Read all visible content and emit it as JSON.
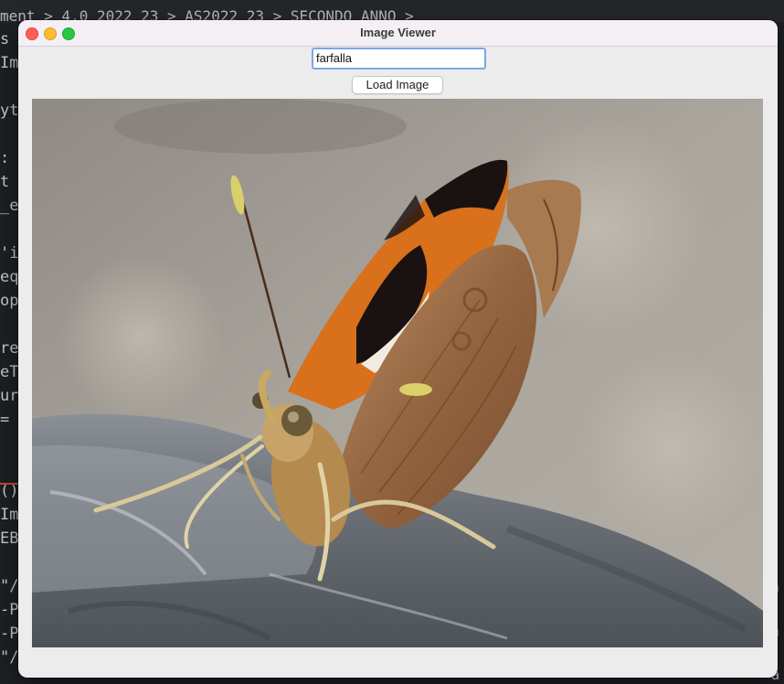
{
  "window": {
    "title": "Image Viewer"
  },
  "search": {
    "value": "farfalla",
    "placeholder": ""
  },
  "toolbar": {
    "load_label": "Load Image"
  },
  "image": {
    "subject": "butterfly",
    "colors": {
      "wing_orange": "#d8701c",
      "wing_black": "#1a1210",
      "wing_brown": "#9a6a44",
      "rock": "#6d7279",
      "background": "#a29d95"
    }
  },
  "background_app": {
    "top_text": "ment > 4.0 2022 23 > AS2022_23 > SECONDO ANNO > ",
    "left_gutter": [
      "s",
      "Im",
      "",
      "yt",
      "",
      ":",
      " t",
      "_e",
      "",
      "'i",
      "eq",
      "op",
      "",
      "re",
      "eT",
      "ur",
      "=",
      "",
      "",
      "()",
      "Im",
      "EB",
      "",
      "\"/",
      "-P",
      "-P",
      "\"/"
    ],
    "right_gutter": [
      "a",
      "",
      "a",
      "",
      "a"
    ]
  }
}
